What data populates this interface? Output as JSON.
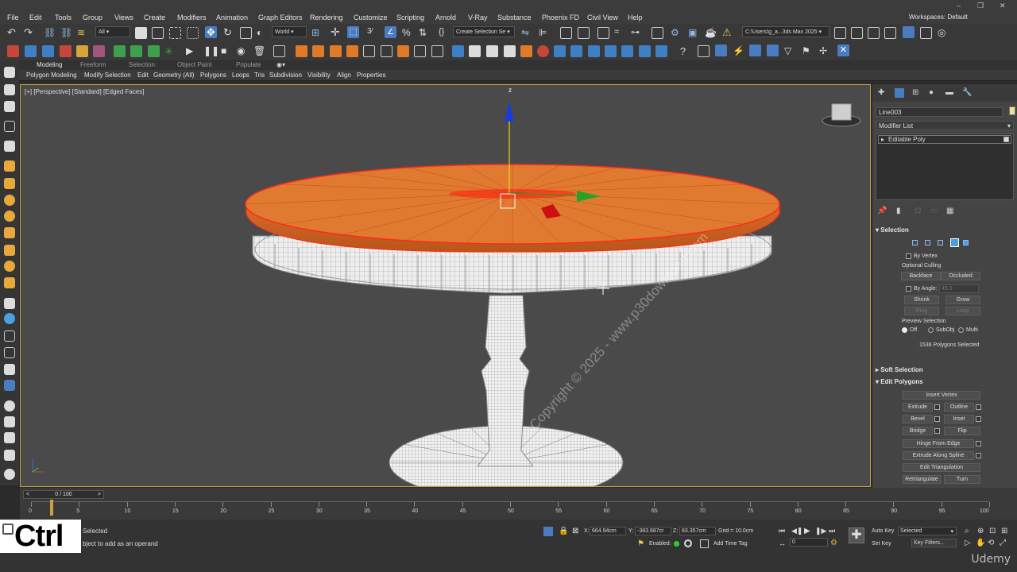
{
  "menu": {
    "items": [
      "File",
      "Edit",
      "Tools",
      "Group",
      "Views",
      "Create",
      "Modifiers",
      "Animation",
      "Graph Editors",
      "Rendering",
      "Customize",
      "Scripting",
      "Arnold",
      "V-Ray",
      "Substance",
      "Phoenix FD",
      "Civil View",
      "Help"
    ],
    "workspaces_label": "Workspaces:",
    "workspaces_value": "Default"
  },
  "toolbar": {
    "filter_value": "All",
    "coord_system": "World",
    "selection_set_placeholder": "Create Selection Se",
    "project_path": "C:\\Users\\g_a...3ds Max 2025"
  },
  "ribbon": {
    "tabs": [
      "Modeling",
      "Freeform",
      "Selection",
      "Object Paint",
      "Populate"
    ],
    "active_tab": "Modeling",
    "buttons": [
      "Polygon Modeling",
      "Modify Selection",
      "Edit",
      "Geometry (All)",
      "Polygons",
      "Loops",
      "Tris",
      "Subdivision",
      "Visibility",
      "Align",
      "Properties"
    ]
  },
  "viewport": {
    "label": "[+] [Perspective] [Standard] [Edged Faces]",
    "axis_z": "z",
    "watermark": "Copyright © 2025 - www.p30download.com"
  },
  "command_panel": {
    "object_name": "Line003",
    "object_color": "#f2dd9a",
    "modifier_list": "Modifier List",
    "stack_item": "Editable Poly",
    "selection": {
      "title": "Selection",
      "by_vertex": "By Vertex",
      "optional_culling": "Optional Culling",
      "backface": "Backface",
      "occluded": "Occluded",
      "by_angle": "By Angle:",
      "by_angle_value": "45.0",
      "shrink": "Shrink",
      "grow": "Grow",
      "ring": "Ring",
      "loop": "Loop",
      "preview_selection": "Preview Selection",
      "preview_off": "Off",
      "preview_subobj": "SubObj",
      "preview_multi": "Multi",
      "status": "1536 Polygons Selected"
    },
    "soft_selection": {
      "title": "Soft Selection"
    },
    "edit_polygons": {
      "title": "Edit Polygons",
      "insert_vertex": "Insert Vertex",
      "extrude": "Extrude",
      "outline": "Outline",
      "bevel": "Bevel",
      "inset": "Inset",
      "bridge": "Bridge",
      "flip": "Flip",
      "hinge_from_edge": "Hinge From Edge",
      "extrude_along_spline": "Extrude Along Spline",
      "edit_triangulation": "Edit Triangulation",
      "retriangulate": "Retriangulate",
      "turn": "Turn"
    }
  },
  "timeline": {
    "slider_label": "0 / 100",
    "ticks": [
      "0",
      "5",
      "10",
      "15",
      "20",
      "25",
      "30",
      "35",
      "40",
      "45",
      "50",
      "55",
      "60",
      "65",
      "70",
      "75",
      "80",
      "85",
      "90",
      "95",
      "100"
    ],
    "progress": 0
  },
  "status": {
    "keyboard_overlay": "Ctrl",
    "selected": "Selected",
    "prompt": "bject to add as an operand",
    "x_label": "X:",
    "x_value": "664.94cm",
    "y_label": "Y:",
    "y_value": "-383.687cr",
    "z_label": "Z:",
    "z_value": "83.357cm",
    "grid": "Grid = 10.0cm",
    "enabled": "Enabled:",
    "add_time_tag": "Add Time Tag",
    "auto_key": "Auto Key",
    "set_key": "Set Key",
    "key_mode": "Selected",
    "key_filters": "Key Filters...",
    "frame": "0",
    "brand": "Udemy"
  }
}
